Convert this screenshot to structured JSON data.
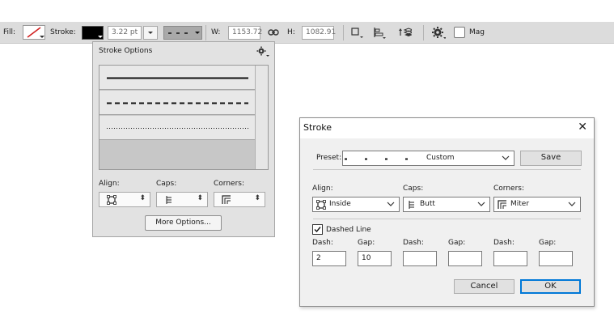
{
  "optionsbar": {
    "fill_label": "Fill:",
    "stroke_label": "Stroke:",
    "stroke_width": "3.22 pt",
    "w_label": "W:",
    "w_value": "1153.72",
    "h_label": "H:",
    "h_value": "1082.91",
    "mag_label": "Mag"
  },
  "stroke_options": {
    "title": "Stroke Options",
    "presets": [
      "solid",
      "dashed",
      "dotted"
    ],
    "align_label": "Align:",
    "caps_label": "Caps:",
    "corners_label": "Corners:",
    "more_options": "More Options..."
  },
  "dialog": {
    "title": "Stroke",
    "preset_label": "Preset:",
    "preset_value": "Custom",
    "save": "Save",
    "align_label": "Align:",
    "align_value": "Inside",
    "caps_label": "Caps:",
    "caps_value": "Butt",
    "corners_label": "Corners:",
    "corners_value": "Miter",
    "dashed_line_label": "Dashed Line",
    "dashed_line_checked": true,
    "dash_label": "Dash:",
    "gap_label": "Gap:",
    "dash_values": [
      "2",
      "",
      ""
    ],
    "gap_values": [
      "10",
      "",
      ""
    ],
    "cancel": "Cancel",
    "ok": "OK"
  },
  "colors": {
    "accent": "#0078d7",
    "fill_slash": "#d12020",
    "stroke_swatch": "#000000"
  }
}
